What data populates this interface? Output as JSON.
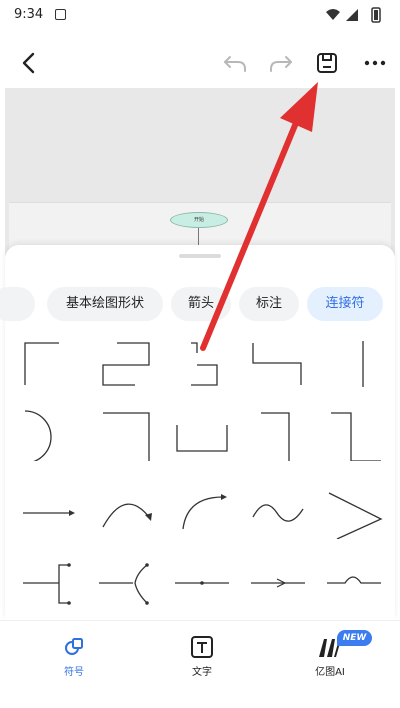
{
  "status_bar": {
    "time": "9:34",
    "app_icon": "notification-icon",
    "wifi_icon": "wifi-icon",
    "signal_icon": "signal-icon",
    "battery_icon": "battery-icon"
  },
  "toolbar": {
    "back_icon": "chevron-left-icon",
    "undo_icon": "undo-icon",
    "redo_icon": "redo-icon",
    "save_icon": "save-icon",
    "more_icon": "more-icon"
  },
  "canvas": {
    "start_node_label": "开始",
    "start_node_color": "#c8eee4"
  },
  "categories": [
    {
      "label": "基本绘图形状",
      "active": false
    },
    {
      "label": "箭头",
      "active": false
    },
    {
      "label": "标注",
      "active": false
    },
    {
      "label": "连接符",
      "active": true
    }
  ],
  "bottom_nav": [
    {
      "label": "符号",
      "icon": "shapes-icon",
      "active": true
    },
    {
      "label": "文字",
      "icon": "text-icon",
      "active": false
    },
    {
      "label": "亿图AI",
      "icon": "ai-logo-icon",
      "badge": "NEW",
      "active": false
    }
  ],
  "colors": {
    "accent": "#2f6fe0",
    "active_chip_bg": "#e5f0ff",
    "annotation_arrow": "#e03030"
  }
}
